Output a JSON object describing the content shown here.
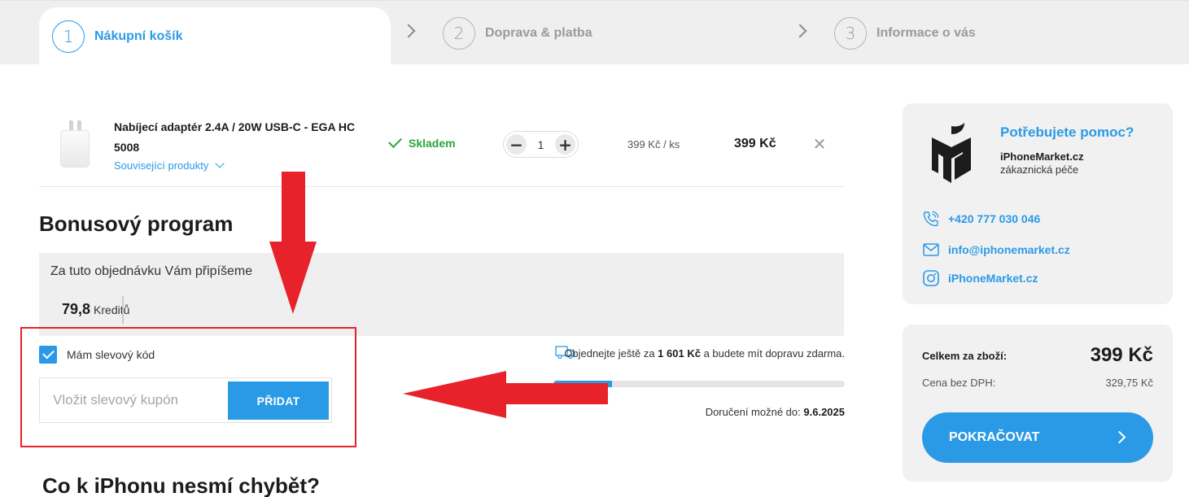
{
  "steps": [
    {
      "number": "1",
      "label": "Nákupní košík"
    },
    {
      "number": "2",
      "label": "Doprava & platba"
    },
    {
      "number": "3",
      "label": "Informace o vás"
    }
  ],
  "cart": {
    "item": {
      "name": "Nabíjecí adaptér 2.4A / 20W USB-C - EGA HC 5008",
      "related_link": "Související produkty",
      "stock": "Skladem",
      "quantity": "1",
      "unit_price": "399 Kč / ks",
      "price": "399 Kč"
    }
  },
  "bonus": {
    "title": "Bonusový program",
    "text": "Za tuto objednávku Vám připíšeme",
    "credits_value": "79,8",
    "credits_unit": "Kreditů"
  },
  "coupon": {
    "checkbox_label": "Mám slevový kód",
    "checked": true,
    "placeholder": "Vložit slevový kupón",
    "button": "PŘIDAT"
  },
  "shipping": {
    "text_before": "Objednejte ještě za",
    "amount": "1 601 Kč",
    "text_after": "a budete mít dopravu zdarma.",
    "progress": 0.2,
    "delivery_label": "Doručení možné do:",
    "delivery_date": "9.6.2025"
  },
  "more_title": "Co k iPhonu nesmí chybět?",
  "help": {
    "title": "Potřebujete pomoc?",
    "brand": "iPhoneMarket.cz",
    "subtitle": "zákaznická péče",
    "phone": "+420 777 030 046",
    "email": "info@iphonemarket.cz",
    "instagram": "iPhoneMarket.cz"
  },
  "summary": {
    "total_label": "Celkem za zboží:",
    "total": "399 Kč",
    "no_vat_label": "Cena bez DPH:",
    "no_vat": "329,75 Kč",
    "continue": "POKRAČOVAT"
  },
  "colors": {
    "accent": "#2a9ae6",
    "in_stock": "#28a53c",
    "annotation": "#e8222a",
    "card_bg": "#f1f1f1"
  }
}
